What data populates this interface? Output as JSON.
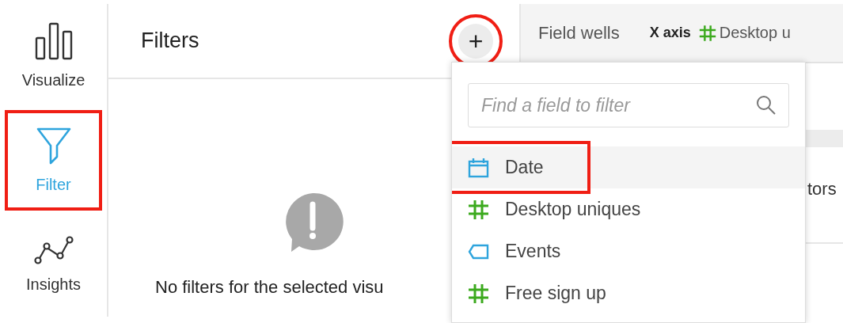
{
  "sidebar": {
    "items": [
      {
        "label": "Visualize",
        "selected": false,
        "highlighted": false
      },
      {
        "label": "Filter",
        "selected": true,
        "highlighted": true
      },
      {
        "label": "Insights",
        "selected": false,
        "highlighted": false
      }
    ]
  },
  "filters_panel": {
    "title": "Filters",
    "add_button": {
      "label": "+",
      "highlighted": true
    },
    "empty_message": "No filters for the selected visu"
  },
  "field_wells": {
    "title": "Field wells",
    "x_axis": {
      "label": "X axis",
      "field": {
        "kind": "measure",
        "name": "Desktop u"
      }
    },
    "column_2": "tors"
  },
  "field_menu": {
    "search": {
      "placeholder": "Find a field to filter"
    },
    "items": [
      {
        "name": "Date",
        "kind": "date",
        "selected": true,
        "highlighted": true
      },
      {
        "name": "Desktop uniques",
        "kind": "measure",
        "selected": false,
        "highlighted": false
      },
      {
        "name": "Events",
        "kind": "dimension",
        "selected": false,
        "highlighted": false
      },
      {
        "name": "Free sign up",
        "kind": "measure",
        "selected": false,
        "highlighted": false
      }
    ]
  }
}
